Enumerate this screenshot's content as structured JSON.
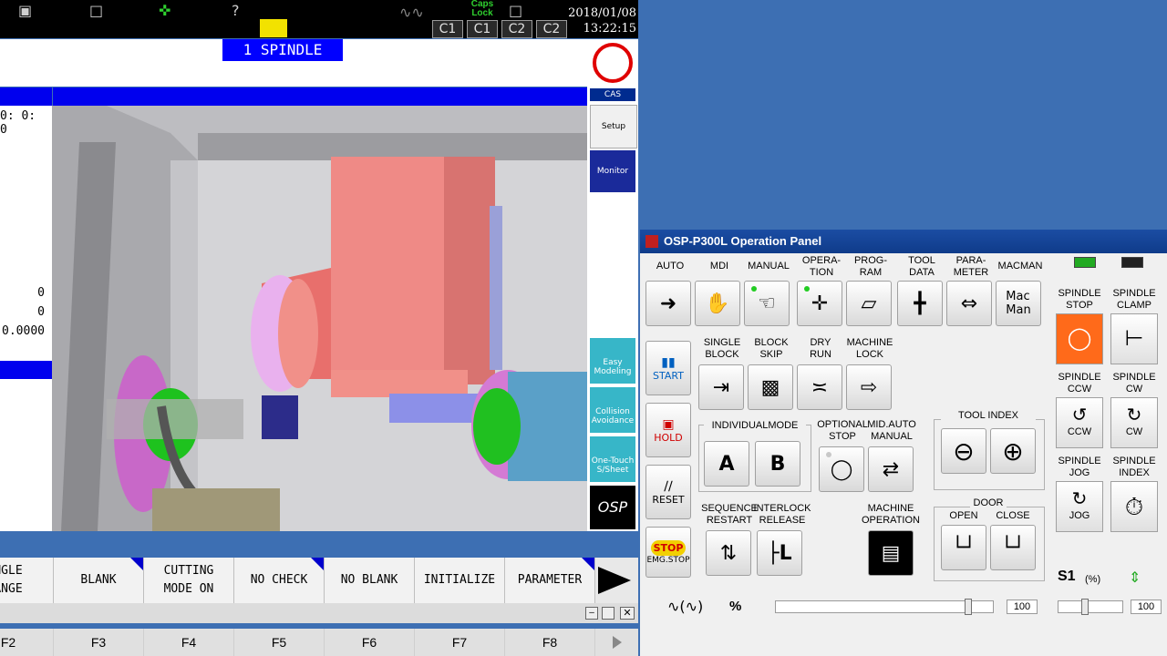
{
  "topbar": {
    "caps_lock": "Caps\nLock",
    "c_labels": [
      "C1",
      "C1",
      "C2",
      "C2"
    ],
    "date": "2018/01/08",
    "time": "13:22:15"
  },
  "spindle_title": "1 SPINDLE",
  "left_info": {
    "clock": "0: 0: 0",
    "v1": "0",
    "v2": "0",
    "v3": "0.0000"
  },
  "sidebar": {
    "cas": "CAS",
    "setup": "Setup",
    "monitor": "Monitor",
    "easy_modeling": "Easy\nModeling",
    "collision_avoidance": "Collision\nAvoidance",
    "one_touch": "One-Touch\nS/Sheet",
    "osp": "OSP"
  },
  "fkeys": [
    {
      "label": "NGLE\nANGE",
      "flag": false
    },
    {
      "label": "BLANK",
      "flag": true
    },
    {
      "label": "CUTTING\nMODE ON",
      "flag": false
    },
    {
      "label": "NO CHECK",
      "flag": true
    },
    {
      "label": "NO BLANK",
      "flag": false
    },
    {
      "label": "INITIALIZE",
      "flag": false
    },
    {
      "label": "PARAMETER",
      "flag": true
    }
  ],
  "fnums": [
    "F2",
    "F3",
    "F4",
    "F5",
    "F6",
    "F7",
    "F8"
  ],
  "panel": {
    "title": "OSP-P300L Operation Panel",
    "modes": [
      "AUTO",
      "MDI",
      "MANUAL",
      "OPERA-\nTION",
      "PROG-\nRAM",
      "TOOL\nDATA",
      "PARA-\nMETER",
      "MACMAN"
    ],
    "macman_btn": "Mac\nMan",
    "start": "START",
    "hold": "HOLD",
    "reset": "RESET",
    "stop": "STOP",
    "emg_stop": "EMG.STOP",
    "single_block": "SINGLE\nBLOCK",
    "block_skip": "BLOCK\nSKIP",
    "dry_run": "DRY\nRUN",
    "machine_lock": "MACHINE\nLOCK",
    "individual_mode": "INDIVIDUALMODE",
    "optional_stop": "OPTIONAL\nSTOP",
    "mid_auto_manual": "MID.AUTO\nMANUAL",
    "tool_index": "TOOL INDEX",
    "sequence_restart": "SEQUENCE\nRESTART",
    "interlock_release": "INTERLOCK\nRELEASE",
    "machine_operation": "MACHINE\nOPERATION",
    "door": "DOOR",
    "open": "OPEN",
    "close": "CLOSE",
    "spindle_stop": "SPINDLE\nSTOP",
    "spindle_clamp": "SPINDLE\nCLAMP",
    "spindle_ccw": "SPINDLE\nCCW",
    "spindle_cw": "SPINDLE\nCW",
    "spindle_jog": "SPINDLE\nJOG",
    "spindle_index": "SPINDLE\nINDEX",
    "ccw": "CCW",
    "cw": "CW",
    "jog": "JOG",
    "s1": "S1",
    "percent": "(%)",
    "override_percent": "%",
    "feed_value": "100",
    "spindle_value": "100",
    "feed_level": 0.9,
    "spindle_level": 0.4
  }
}
